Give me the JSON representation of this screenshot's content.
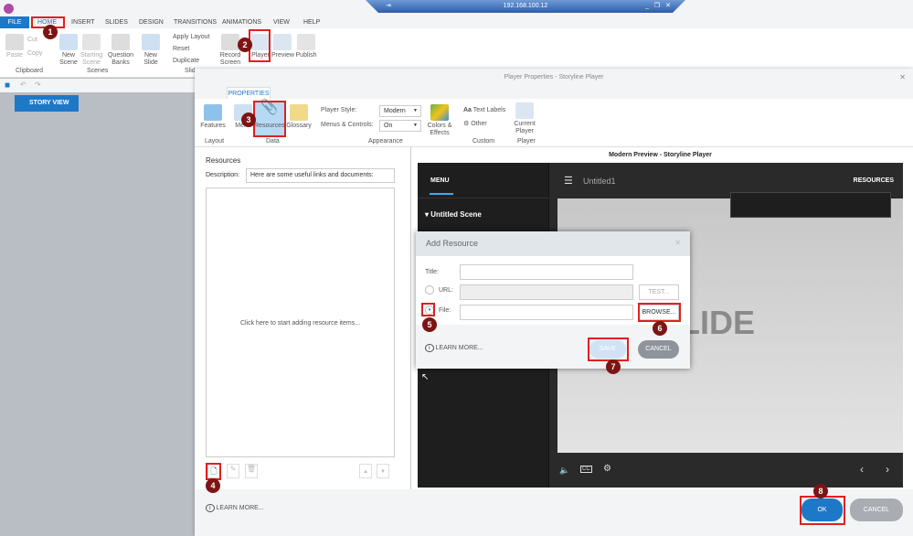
{
  "remote": {
    "host": "192.168.100.12"
  },
  "app_tabs": [
    "FILE",
    "HOME",
    "INSERT",
    "SLIDES",
    "DESIGN",
    "TRANSITIONS",
    "ANIMATIONS",
    "VIEW",
    "HELP"
  ],
  "ribbon": {
    "paste": "Paste",
    "cut": "Cut",
    "copy": "Copy",
    "clipboard": "Clipboard",
    "new_scene": "New Scene",
    "starting_scene": "Starting Scene",
    "question_banks": "Question Banks",
    "scenes": "Scenes",
    "new_slide": "New Slide",
    "apply_layout": "Apply Layout",
    "reset": "Reset",
    "duplicate": "Duplicate",
    "slide_group": "Slid",
    "record_screen": "Record Screen",
    "player": "Player",
    "preview": "Preview",
    "publish": "Publish"
  },
  "story_view": "STORY VIEW",
  "dialog": {
    "title": "Player Properties - Storyline Player",
    "tab": "PROPERTIES",
    "ribbon": {
      "features": "Features",
      "layout": "Layout",
      "menu": "Menu",
      "resources": "Resources",
      "glossary": "Glossary",
      "data": "Data",
      "player_style_label": "Player Style:",
      "player_style": "Modern",
      "menus_label": "Menus & Controls:",
      "menus": "On",
      "colors": "Colors & Effects",
      "appearance": "Appearance",
      "text_labels": "Text Labels",
      "other": "Other",
      "custom": "Custom",
      "current_player": "Current Player",
      "player": "Player"
    },
    "resources_heading": "Resources",
    "description_label": "Description:",
    "description_value": "Here are some useful links and documents:",
    "empty_list": "Click here to start adding resource items...",
    "learn_more": "LEARN MORE...",
    "ok": "OK",
    "cancel": "CANCEL"
  },
  "preview": {
    "title": "Modern Preview - Storyline Player",
    "menu": "MENU",
    "course_title": "Untitled1",
    "resources": "RESOURCES",
    "scene": "Untitled Scene",
    "slide_text": "SLIDE"
  },
  "add_resource": {
    "title": "Add Resource",
    "title_label": "Title:",
    "url_label": "URL:",
    "file_label": "File:",
    "test": "TEST...",
    "browse": "BROWSE...",
    "learn_more": "LEARN MORE...",
    "save": "SAVE",
    "cancel": "CANCEL"
  },
  "steps": [
    "1",
    "2",
    "3",
    "4",
    "5",
    "6",
    "7",
    "8"
  ]
}
